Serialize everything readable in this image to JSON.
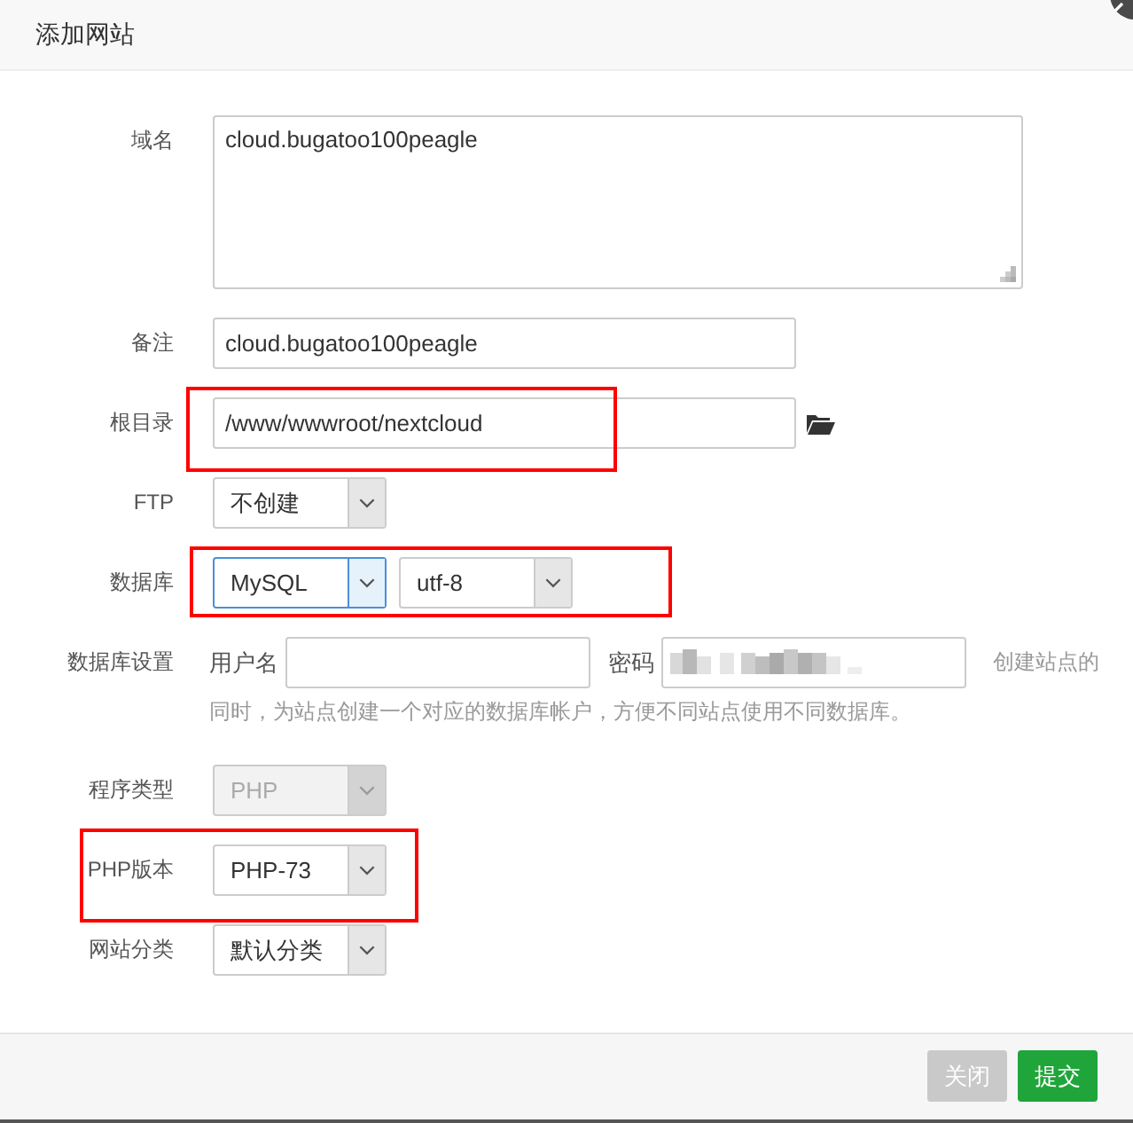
{
  "dialog": {
    "title": "添加网站"
  },
  "form": {
    "rows": [
      {
        "kind": "textarea",
        "label": "域名",
        "value": "cloud.bugatoo100peagle",
        "highlighted": false
      },
      {
        "kind": "text",
        "label": "备注",
        "value": "cloud.bugatoo100peagle",
        "highlighted": false
      },
      {
        "kind": "path",
        "label": "根目录",
        "value": "/www/wwwroot/nextcloud",
        "highlighted": true
      },
      {
        "kind": "select",
        "label": "FTP",
        "selects": [
          {
            "value": "不创建",
            "focused": false,
            "disabled": false
          }
        ],
        "highlighted": false
      },
      {
        "kind": "select",
        "label": "数据库",
        "selects": [
          {
            "value": "MySQL",
            "focused": true,
            "disabled": false
          },
          {
            "value": "utf-8",
            "focused": false,
            "disabled": false
          }
        ],
        "highlighted": true
      },
      {
        "kind": "credentials",
        "label": "数据库设置",
        "username_label": "用户名",
        "password_label": "密码",
        "password_obscured": true,
        "hint": [
          "创建站点的",
          "同时，为站点创建一个对应的数据库帐户，方便不同站点使用不同数据库。"
        ],
        "highlighted": false
      },
      {
        "kind": "select",
        "label": "程序类型",
        "selects": [
          {
            "value": "PHP",
            "focused": false,
            "disabled": true
          }
        ],
        "highlighted": false
      },
      {
        "kind": "select",
        "label": "PHP版本",
        "selects": [
          {
            "value": "PHP-73",
            "focused": false,
            "disabled": false
          }
        ],
        "highlighted": true
      },
      {
        "kind": "select",
        "label": "网站分类",
        "selects": [
          {
            "value": "默认分类",
            "focused": false,
            "disabled": false
          }
        ],
        "highlighted": false
      }
    ]
  },
  "buttons": [
    {
      "label": "关闭",
      "kind": "secondary"
    },
    {
      "label": "提交",
      "kind": "primary"
    }
  ]
}
